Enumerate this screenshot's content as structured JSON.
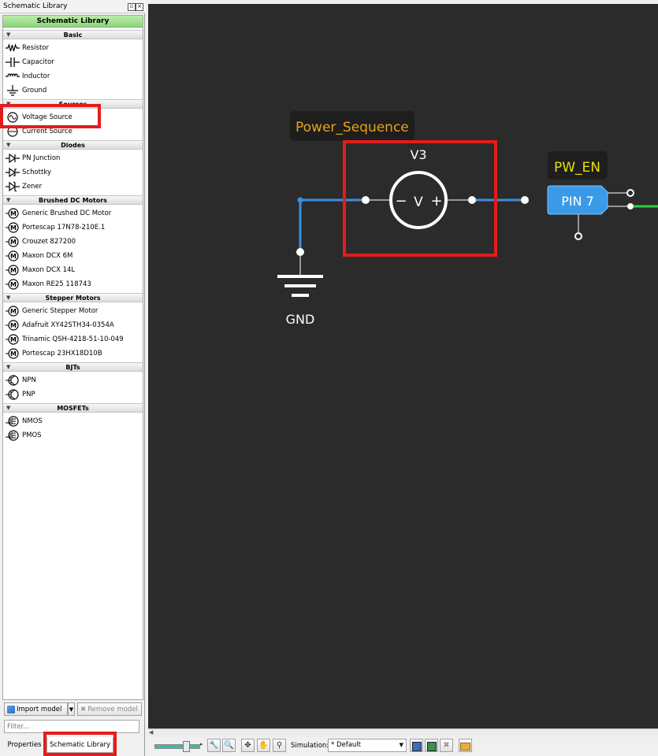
{
  "panel": {
    "title": "Schematic Library",
    "library_header": "Schematic Library"
  },
  "library": {
    "basic": {
      "title": "Basic",
      "items": [
        {
          "label": "Resistor",
          "icon": "resistor-icon"
        },
        {
          "label": "Capacitor",
          "icon": "capacitor-icon"
        },
        {
          "label": "Inductor",
          "icon": "inductor-icon"
        },
        {
          "label": "Ground",
          "icon": "ground-icon"
        }
      ]
    },
    "sources": {
      "title": "Sources",
      "items": [
        {
          "label": "Voltage Source",
          "icon": "voltage-source-icon"
        },
        {
          "label": "Current Source",
          "icon": "current-source-icon"
        }
      ]
    },
    "diodes": {
      "title": "Diodes",
      "items": [
        {
          "label": "PN Junction",
          "icon": "diode-icon"
        },
        {
          "label": "Schottky",
          "icon": "schottky-icon"
        },
        {
          "label": "Zener",
          "icon": "zener-icon"
        }
      ]
    },
    "brushed": {
      "title": "Brushed DC Motors",
      "items": [
        {
          "label": "Generic Brushed DC Motor",
          "icon": "motor-icon"
        },
        {
          "label": "Portescap 17N78-210E.1",
          "icon": "motor-icon"
        },
        {
          "label": "Crouzet 827200",
          "icon": "motor-icon"
        },
        {
          "label": "Maxon DCX 6M",
          "icon": "motor-icon"
        },
        {
          "label": "Maxon DCX 14L",
          "icon": "motor-icon"
        },
        {
          "label": "Maxon RE25 118743",
          "icon": "motor-icon"
        }
      ]
    },
    "stepper": {
      "title": "Stepper Motors",
      "items": [
        {
          "label": "Generic Stepper Motor",
          "icon": "motor-icon"
        },
        {
          "label": "Adafruit XY42STH34-0354A",
          "icon": "motor-icon"
        },
        {
          "label": "Trinamic QSH-4218-51-10-049",
          "icon": "motor-icon"
        },
        {
          "label": "Portescap 23HX18D10B",
          "icon": "motor-icon"
        }
      ]
    },
    "bjts": {
      "title": "BJTs",
      "items": [
        {
          "label": "NPN",
          "icon": "npn-transistor-icon"
        },
        {
          "label": "PNP",
          "icon": "pnp-transistor-icon"
        }
      ]
    },
    "mosfets": {
      "title": "MOSFETs",
      "items": [
        {
          "label": "NMOS",
          "icon": "nmos-icon"
        },
        {
          "label": "PMOS",
          "icon": "pmos-icon"
        }
      ]
    }
  },
  "toolbar": {
    "import_label": "Import model",
    "remove_label": "Remove model",
    "filter_placeholder": "Filter..."
  },
  "tabs": {
    "properties": "Properties",
    "schematic_library": "Schematic Library"
  },
  "status": {
    "simulation_label": "Simulation:",
    "simulation_value": "* Default"
  },
  "schematic": {
    "block_label": "Power_Sequence",
    "source_name": "V3",
    "source_symbol": "V",
    "source_minus": "−",
    "source_plus": "+",
    "ground_label": "GND",
    "pin_name": "PW_EN",
    "pin_label": "PIN 7"
  },
  "colors": {
    "canvas": "#2b2b2b",
    "wire": "#3a8fe0",
    "highlight": "#e51b1b",
    "label_orange": "#e8a317",
    "label_yellow": "#e8e000",
    "pin_blue": "#3b9ae8",
    "wire_green": "#2ecc40"
  }
}
